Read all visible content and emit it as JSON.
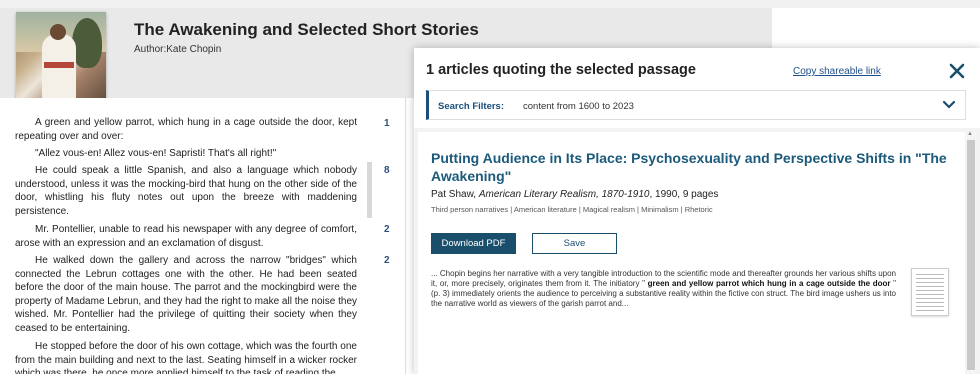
{
  "book": {
    "title": "The Awakening and Selected Short Stories",
    "author": "Author:Kate Chopin"
  },
  "text_panel": {
    "paragraphs": [
      {
        "text": "A green and yellow parrot, which hung in a cage outside the door, kept repeating over and over:",
        "count": "1"
      },
      {
        "text": "\"Allez vous-en! Allez vous-en! Sapristi! That's all right!\"",
        "count": ""
      },
      {
        "text": "He could speak a little Spanish, and also a language which nobody understood, unless it was the mocking-bird that hung on the other side of the door, whistling his fluty notes out upon the breeze with maddening persistence.",
        "count": "8"
      },
      {
        "text": "Mr. Pontellier, unable to read his newspaper with any degree of comfort, arose with an expression and an exclamation of disgust.",
        "count": "2"
      },
      {
        "text": "He walked down the gallery and across the narrow \"bridges\" which connected the Lebrun cottages one with the other. He had been seated before the door of the main house. The parrot and the mockingbird were the property of Madame Lebrun, and they had the right to make all the noise they wished. Mr. Pontellier had the privilege of quitting their society when they ceased to be entertaining.",
        "count": "2"
      },
      {
        "text": "He stopped before the door of his own cottage, which was the fourth one from the main building and next to the last. Seating himself in a wicker rocker which was there, he once more applied himself to the task of reading the",
        "count": ""
      }
    ]
  },
  "overlay": {
    "title": "1 articles quoting the selected passage",
    "copy_link": "Copy shareable link",
    "filters_label": "Search Filters:",
    "filters_value": "content from 1600 to 2023",
    "article": {
      "title": "Putting Audience in Its Place: Psychosexuality and Perspective Shifts in \"The Awakening\"",
      "author": "Pat Shaw,",
      "journal": "American Literary Realism, 1870-1910",
      "meta_tail": ", 1990, 9 pages",
      "tags": "Third person narratives | American literature | Magical realism | Minimalism | Rhetoric",
      "download_label": "Download PDF",
      "save_label": "Save",
      "snippet_before": "... Chopin begins her narrative with a very tangible introduction to the scientific mode and thereafter grounds her various shifts upon it, or, more precisely, originates them from it. The initiatory \"",
      "snippet_bold": " green and yellow parrot which hung in a cage outside the door ",
      "snippet_after": "\" (p. 3) immediately orients the audience to perceiving a substantive reality within the fictive con struct. The bird image ushers us into the narrative world as viewers of the garish parrot and..."
    }
  },
  "colors": {
    "accent": "#1a4f6c",
    "title_link": "#1b5a7a",
    "count": "#2c4f7c"
  },
  "icons": [
    "close-icon",
    "chevron-down-icon",
    "book-cover-image",
    "article-thumbnail"
  ]
}
